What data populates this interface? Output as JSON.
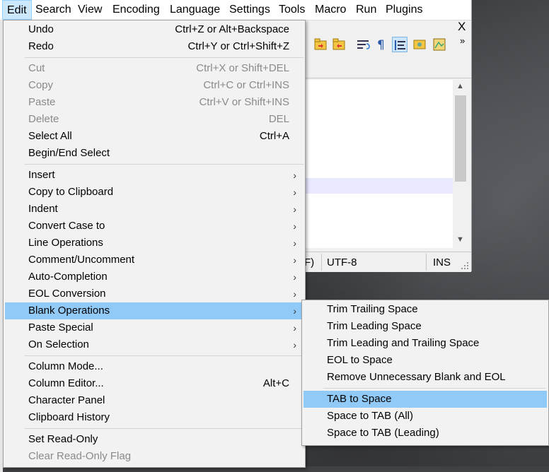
{
  "menubar": {
    "items": [
      "Edit",
      "Search",
      "View",
      "Encoding",
      "Language",
      "Settings",
      "Tools",
      "Macro",
      "Run",
      "Plugins"
    ],
    "close": "X"
  },
  "toolbar": {
    "more": "»",
    "icons": [
      "folder-sync-icon",
      "folder-sync-2-icon",
      "word-wrap-icon",
      "pilcrow-icon",
      "indent-guide-icon",
      "user-lang-icon",
      "map-icon"
    ]
  },
  "statusbar": {
    "eol_tail": "F)",
    "encoding": "UTF-8",
    "mode": "INS"
  },
  "edit_menu": {
    "undo": {
      "label": "Undo",
      "shortcut": "Ctrl+Z or Alt+Backspace"
    },
    "redo": {
      "label": "Redo",
      "shortcut": "Ctrl+Y or Ctrl+Shift+Z"
    },
    "cut": {
      "label": "Cut",
      "shortcut": "Ctrl+X or Shift+DEL"
    },
    "copy": {
      "label": "Copy",
      "shortcut": "Ctrl+C or Ctrl+INS"
    },
    "paste": {
      "label": "Paste",
      "shortcut": "Ctrl+V or Shift+INS"
    },
    "delete": {
      "label": "Delete",
      "shortcut": "DEL"
    },
    "select_all": {
      "label": "Select All",
      "shortcut": "Ctrl+A"
    },
    "begin_end_select": {
      "label": "Begin/End Select"
    },
    "insert": {
      "label": "Insert"
    },
    "copy_to_clipboard": {
      "label": "Copy to Clipboard"
    },
    "indent": {
      "label": "Indent"
    },
    "convert_case": {
      "label": "Convert Case to"
    },
    "line_operations": {
      "label": "Line Operations"
    },
    "comment": {
      "label": "Comment/Uncomment"
    },
    "auto_completion": {
      "label": "Auto-Completion"
    },
    "eol_conversion": {
      "label": "EOL Conversion"
    },
    "blank_operations": {
      "label": "Blank Operations"
    },
    "paste_special": {
      "label": "Paste Special"
    },
    "on_selection": {
      "label": "On Selection"
    },
    "column_mode": {
      "label": "Column Mode..."
    },
    "column_editor": {
      "label": "Column Editor...",
      "shortcut": "Alt+C"
    },
    "character_panel": {
      "label": "Character Panel"
    },
    "clipboard_history": {
      "label": "Clipboard History"
    },
    "set_read_only": {
      "label": "Set Read-Only"
    },
    "clear_read_only": {
      "label": "Clear Read-Only Flag"
    },
    "submenu_arrow": "›"
  },
  "blank_submenu": {
    "trim_trailing": "Trim Trailing Space",
    "trim_leading": "Trim Leading Space",
    "trim_both": "Trim Leading and Trailing Space",
    "eol_to_space": "EOL to Space",
    "remove_unnecessary": "Remove Unnecessary Blank and EOL",
    "tab_to_space": "TAB to Space",
    "space_to_tab_all": "Space to TAB (All)",
    "space_to_tab_leading": "Space to TAB (Leading)"
  }
}
